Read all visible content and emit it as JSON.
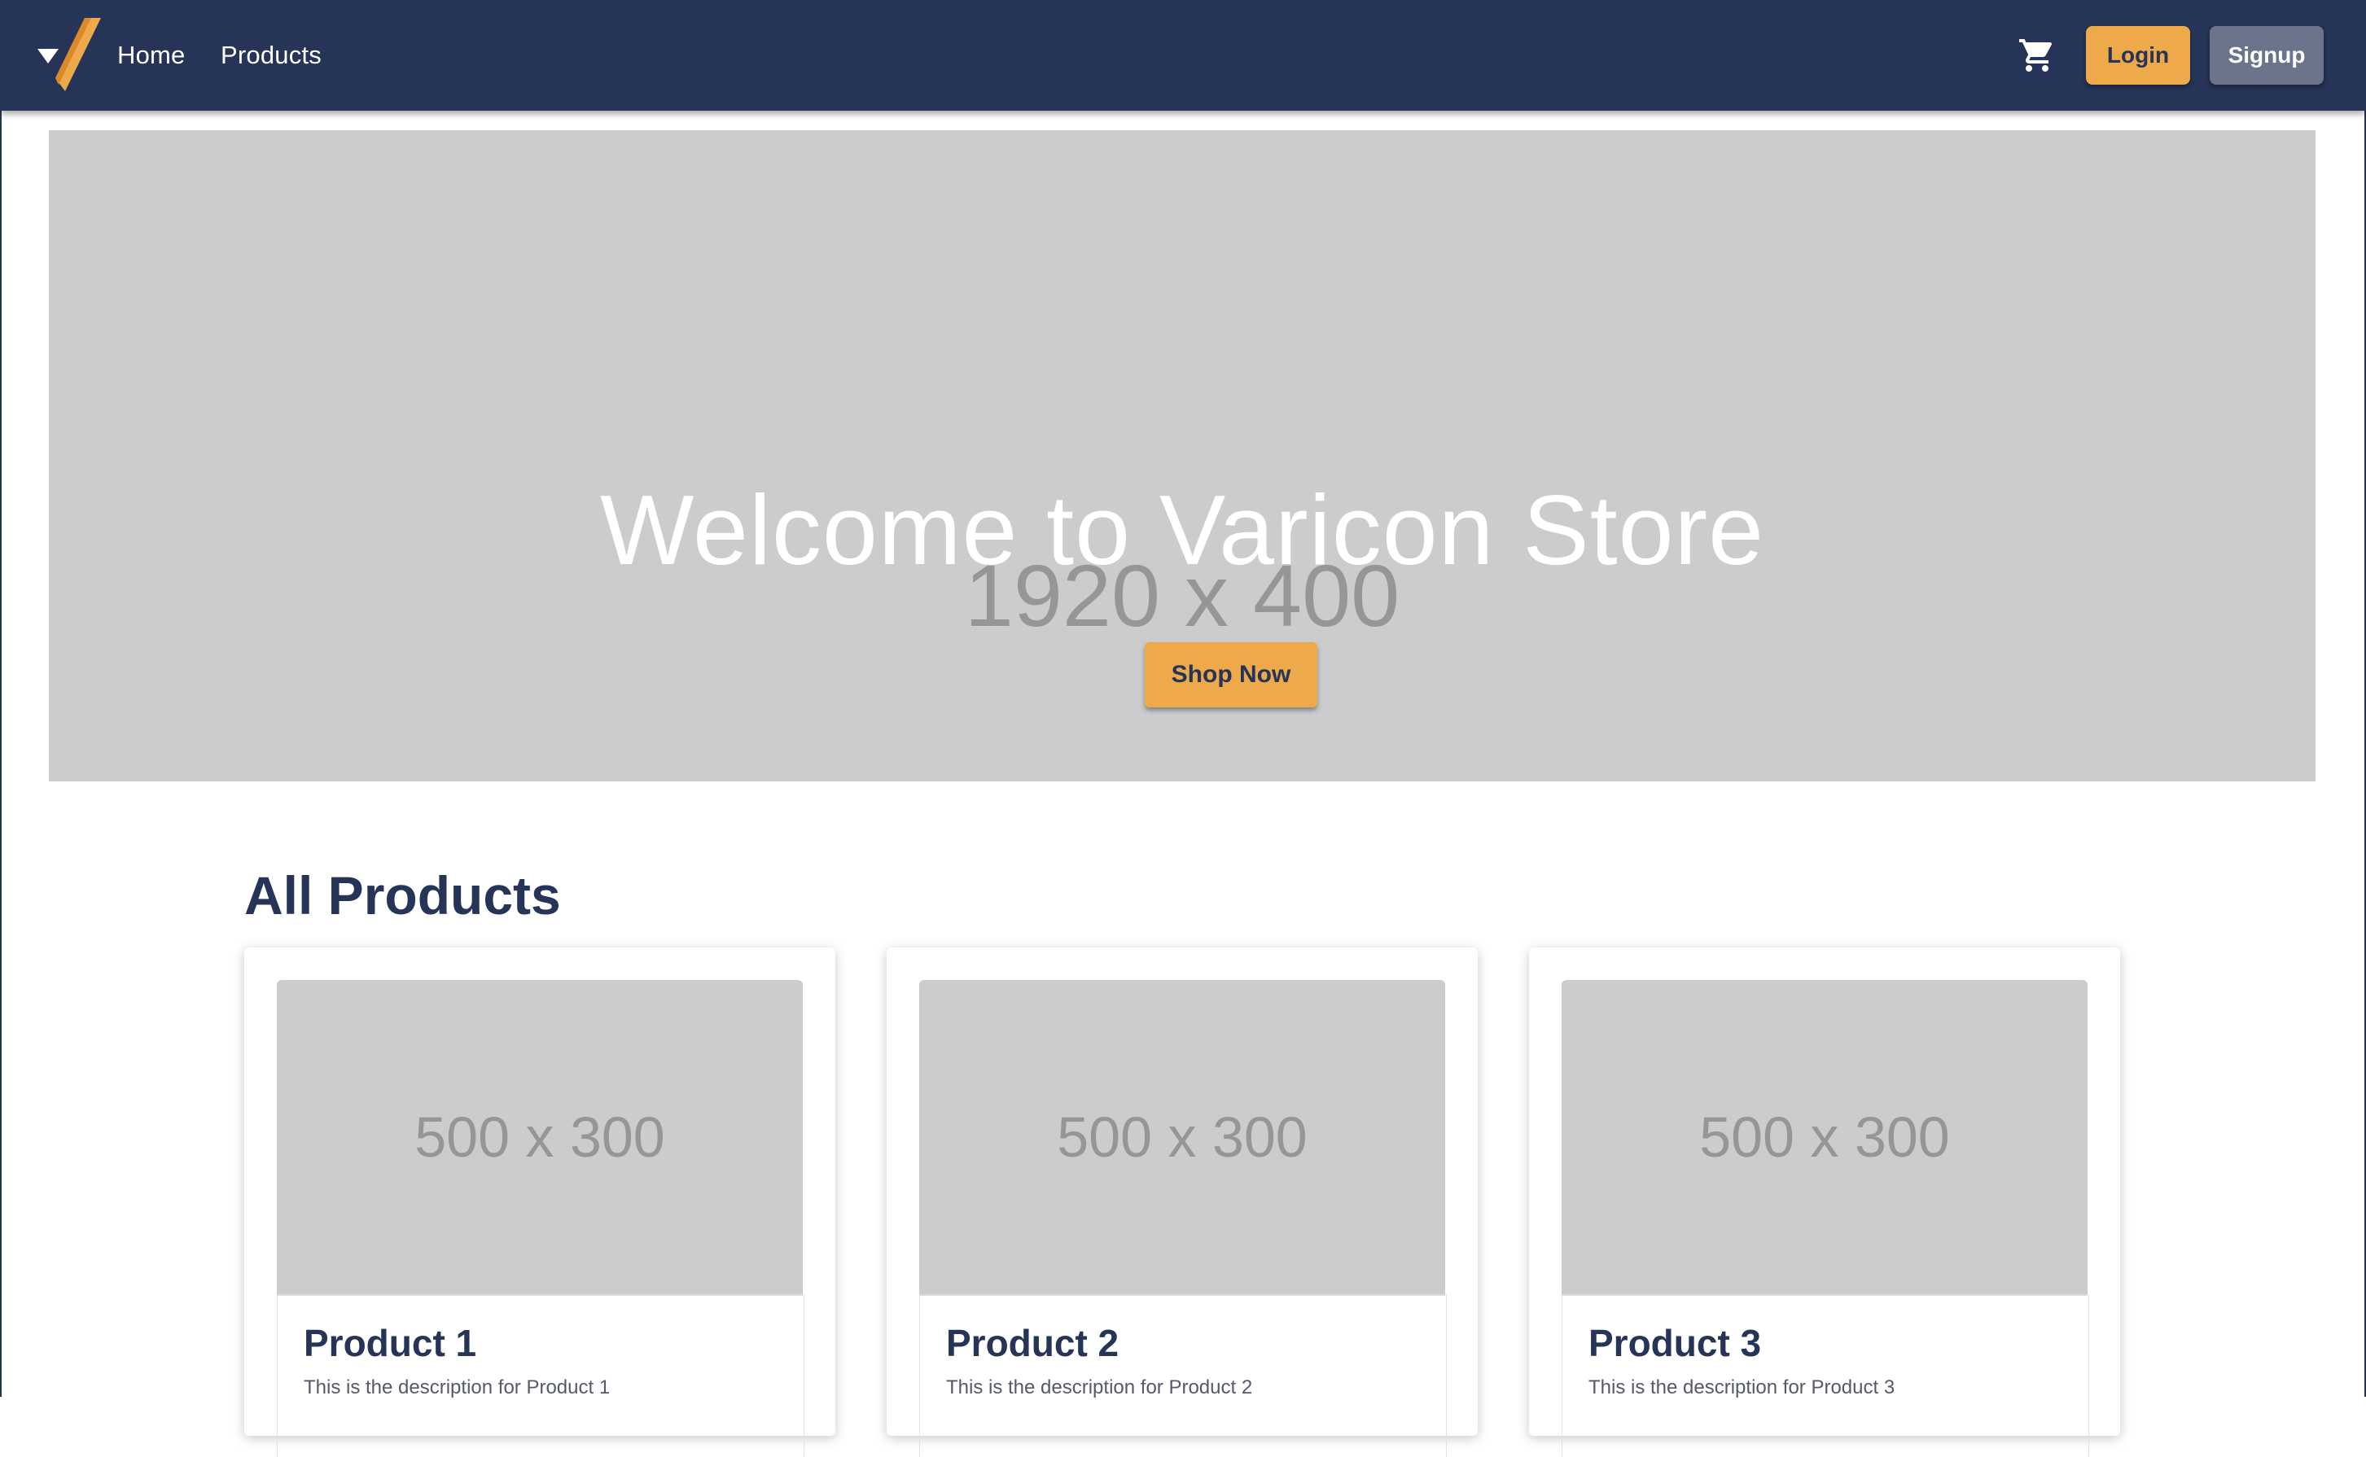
{
  "header": {
    "nav": [
      {
        "label": "Home"
      },
      {
        "label": "Products"
      }
    ],
    "cart_icon": "shopping-cart-icon",
    "login_label": "Login",
    "signup_label": "Signup"
  },
  "hero": {
    "placeholder": "1920 x 400",
    "title": "Welcome to Varicon Store",
    "cta_label": "Shop Now"
  },
  "products": {
    "heading": "All Products",
    "items": [
      {
        "image_placeholder": "500 x 300",
        "name": "Product 1",
        "description": "This is the description for Product 1"
      },
      {
        "image_placeholder": "500 x 300",
        "name": "Product 2",
        "description": "This is the description for Product 2"
      },
      {
        "image_placeholder": "500 x 300",
        "name": "Product 3",
        "description": "This is the description for Product 3"
      }
    ]
  },
  "colors": {
    "navbar": "#253457",
    "accent": "#eea94a",
    "secondary": "#6b748a",
    "placeholder": "#cccccc"
  }
}
